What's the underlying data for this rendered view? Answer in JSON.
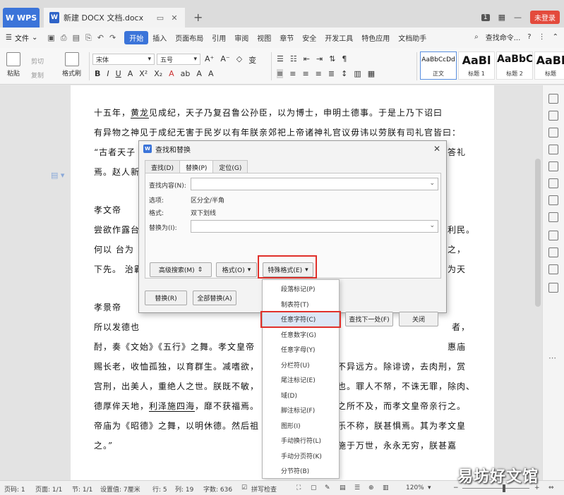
{
  "titlebar": {
    "app_tab": "WPS",
    "doc_tab": "新建 DOCX 文档.docx",
    "doc_icon": "W",
    "new_tab": "+",
    "badge": "1",
    "login": "未登录"
  },
  "menubar": {
    "file": "文件",
    "items": [
      "开始",
      "插入",
      "页面布局",
      "引用",
      "审阅",
      "视图",
      "章节",
      "安全",
      "开发工具",
      "特色应用",
      "文档助手"
    ],
    "active": "开始",
    "search": "查找命令...",
    "help": "?"
  },
  "ribbon": {
    "paste": "粘贴",
    "cut": "剪切",
    "copy": "复制",
    "format_painter": "格式刷",
    "font": "宋体",
    "size": "五号",
    "styles": [
      {
        "preview": "AaBbCcDd",
        "label": "正文"
      },
      {
        "preview": "AaBl",
        "label": "标题 1"
      },
      {
        "preview": "AaBbC",
        "label": "标题 2"
      },
      {
        "preview": "AaBl",
        "label": "标题"
      }
    ]
  },
  "document": {
    "lines": [
      {
        "segments": [
          {
            "t": "    十五年，",
            "u": false
          },
          {
            "t": "黄龙",
            "u": true
          },
          {
            "t": "见成纪，天子乃复召鲁公孙臣，以为博士，申明土德事。于是上乃下诏曰",
            "u": false
          }
        ]
      },
      {
        "segments": [
          {
            "t": "有异物之神见于成纪无害于民岁以有年朕亲郊祀上帝诸神礼官议毋讳以劳朕有司礼官皆曰：",
            "u": false
          }
        ]
      },
      {
        "segments": [
          {
            "t": "“古者天子",
            "u": false
          }
        ]
      },
      {
        "segments": [
          {
            "t": "焉。赵人新",
            "u": false
          }
        ]
      },
      {
        "segments": [
          {
            "t": "    孝文帝",
            "u": false
          }
        ]
      },
      {
        "segments": [
          {
            "t": "尝欲作露台",
            "u": false
          }
        ]
      },
      {
        "segments": [
          {
            "t": "何以 台为",
            "u": false
          }
        ]
      },
      {
        "segments": [
          {
            "t": "下先。 治霸",
            "u": false
          }
        ]
      },
      {
        "segments": [
          {
            "t": "    孝景帝",
            "u": false
          }
        ]
      },
      {
        "segments": [
          {
            "t": "所以发德也",
            "u": false
          }
        ]
      },
      {
        "segments": [
          {
            "t": "酎，奏《文始》《五行》之舞。孝文皇帝",
            "u": false
          }
        ]
      },
      {
        "segments": [
          {
            "t": "赐长老，收恤孤独，以育群生。减嗜欲，",
            "u": false
          }
        ]
      },
      {
        "segments": [
          {
            "t": "宫刑，出美人，重绝人之世。朕既不敏，",
            "u": false
          }
        ]
      },
      {
        "segments": [
          {
            "t": "德厚侔天地，",
            "u": false
          },
          {
            "t": "利泽施四海",
            "u": true
          },
          {
            "t": "，靡不获福焉。",
            "u": false
          }
        ]
      },
      {
        "segments": [
          {
            "t": "帝庙为《昭德》之舞，以明休德。然后祖",
            "u": false
          }
        ]
      },
      {
        "segments": [
          {
            "t": "之。”",
            "u": false
          }
        ]
      }
    ],
    "right_fragments": [
      {
        "line": 2,
        "text": "答礼"
      },
      {
        "line": 5,
        "text": "利民。"
      },
      {
        "line": 6,
        "text": "之，"
      },
      {
        "line": 7,
        "text": "为天"
      },
      {
        "line": 9,
        "text": "者，"
      },
      {
        "line": 10,
        "text": "惠庙"
      },
      {
        "line": 11,
        "text": "不异远方。除诽谤，去肉刑，赏"
      },
      {
        "line": 12,
        "text": "也。罪人不帑，不诛无罪，除肉、"
      },
      {
        "line": 13,
        "text": "之所不及，而孝文皇帝亲行之。"
      },
      {
        "line": 14,
        "text": "乐不称，朕甚惧焉。其为孝文皇"
      },
      {
        "line": 15,
        "text": "施于万世，永永无穷，朕甚嘉"
      }
    ]
  },
  "dialog": {
    "title": "查找和替换",
    "close": "✕",
    "tabs": [
      "查找(D)",
      "替换(P)",
      "定位(G)"
    ],
    "active_tab": "替换(P)",
    "find_label": "查找内容(N):",
    "find_value": "",
    "options_label": "选项:",
    "options_value": "区分全/半角",
    "format_label": "格式:",
    "format_value": "双下划线",
    "replace_label": "替换为(I):",
    "replace_value": "",
    "buttons": {
      "advanced": "高级搜索(M)",
      "format": "格式(O)",
      "special": "特殊格式(E)",
      "replace": "替换(R)",
      "replace_all": "全部替换(A)",
      "find_next": "查找下一处(F)",
      "close": "关闭"
    }
  },
  "dropdown": {
    "items": [
      "段落标记(P)",
      "制表符(T)",
      "任意字符(C)",
      "任意数字(G)",
      "任意字母(Y)",
      "分栏符(U)",
      "尾注标记(E)",
      "域(D)",
      "脚注标记(F)",
      "图形(I)",
      "手动换行符(L)",
      "手动分页符(K)",
      "分节符(B)"
    ],
    "highlighted": "任意字符(C)"
  },
  "statusbar": {
    "page": "页码: 1",
    "pages": "页面: 1/1",
    "section": "节: 1/1",
    "position": "设置值: 7厘米",
    "row": "行: 5",
    "col": "列: 19",
    "words": "字数: 636",
    "spell": "拼写检查",
    "zoom": "120%"
  },
  "watermark": "易坊好文馆",
  "colors": {
    "accent": "#3b74d9",
    "highlight": "#e0302a",
    "login": "#e34a3c"
  }
}
